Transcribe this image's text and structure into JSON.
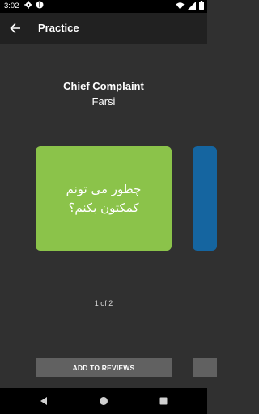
{
  "status_bar": {
    "time": "3:02",
    "icons": [
      "settings-icon",
      "alert-icon",
      "wifi-icon",
      "signal-icon",
      "battery-icon"
    ]
  },
  "app_bar": {
    "title": "Practice",
    "back_icon": "arrow-left-icon"
  },
  "header": {
    "title": "Chief Complaint",
    "subtitle": "Farsi"
  },
  "card": {
    "text": "چطور می تونم کمکتون بکنم؟",
    "color": "#8bc34a",
    "next_card_color": "#1565a0"
  },
  "pager": {
    "text": "1 of 2"
  },
  "actions": {
    "add_to_reviews": "ADD TO REVIEWS"
  },
  "nav_bar": {
    "icons": [
      "back-triangle-icon",
      "home-circle-icon",
      "recents-square-icon"
    ]
  }
}
